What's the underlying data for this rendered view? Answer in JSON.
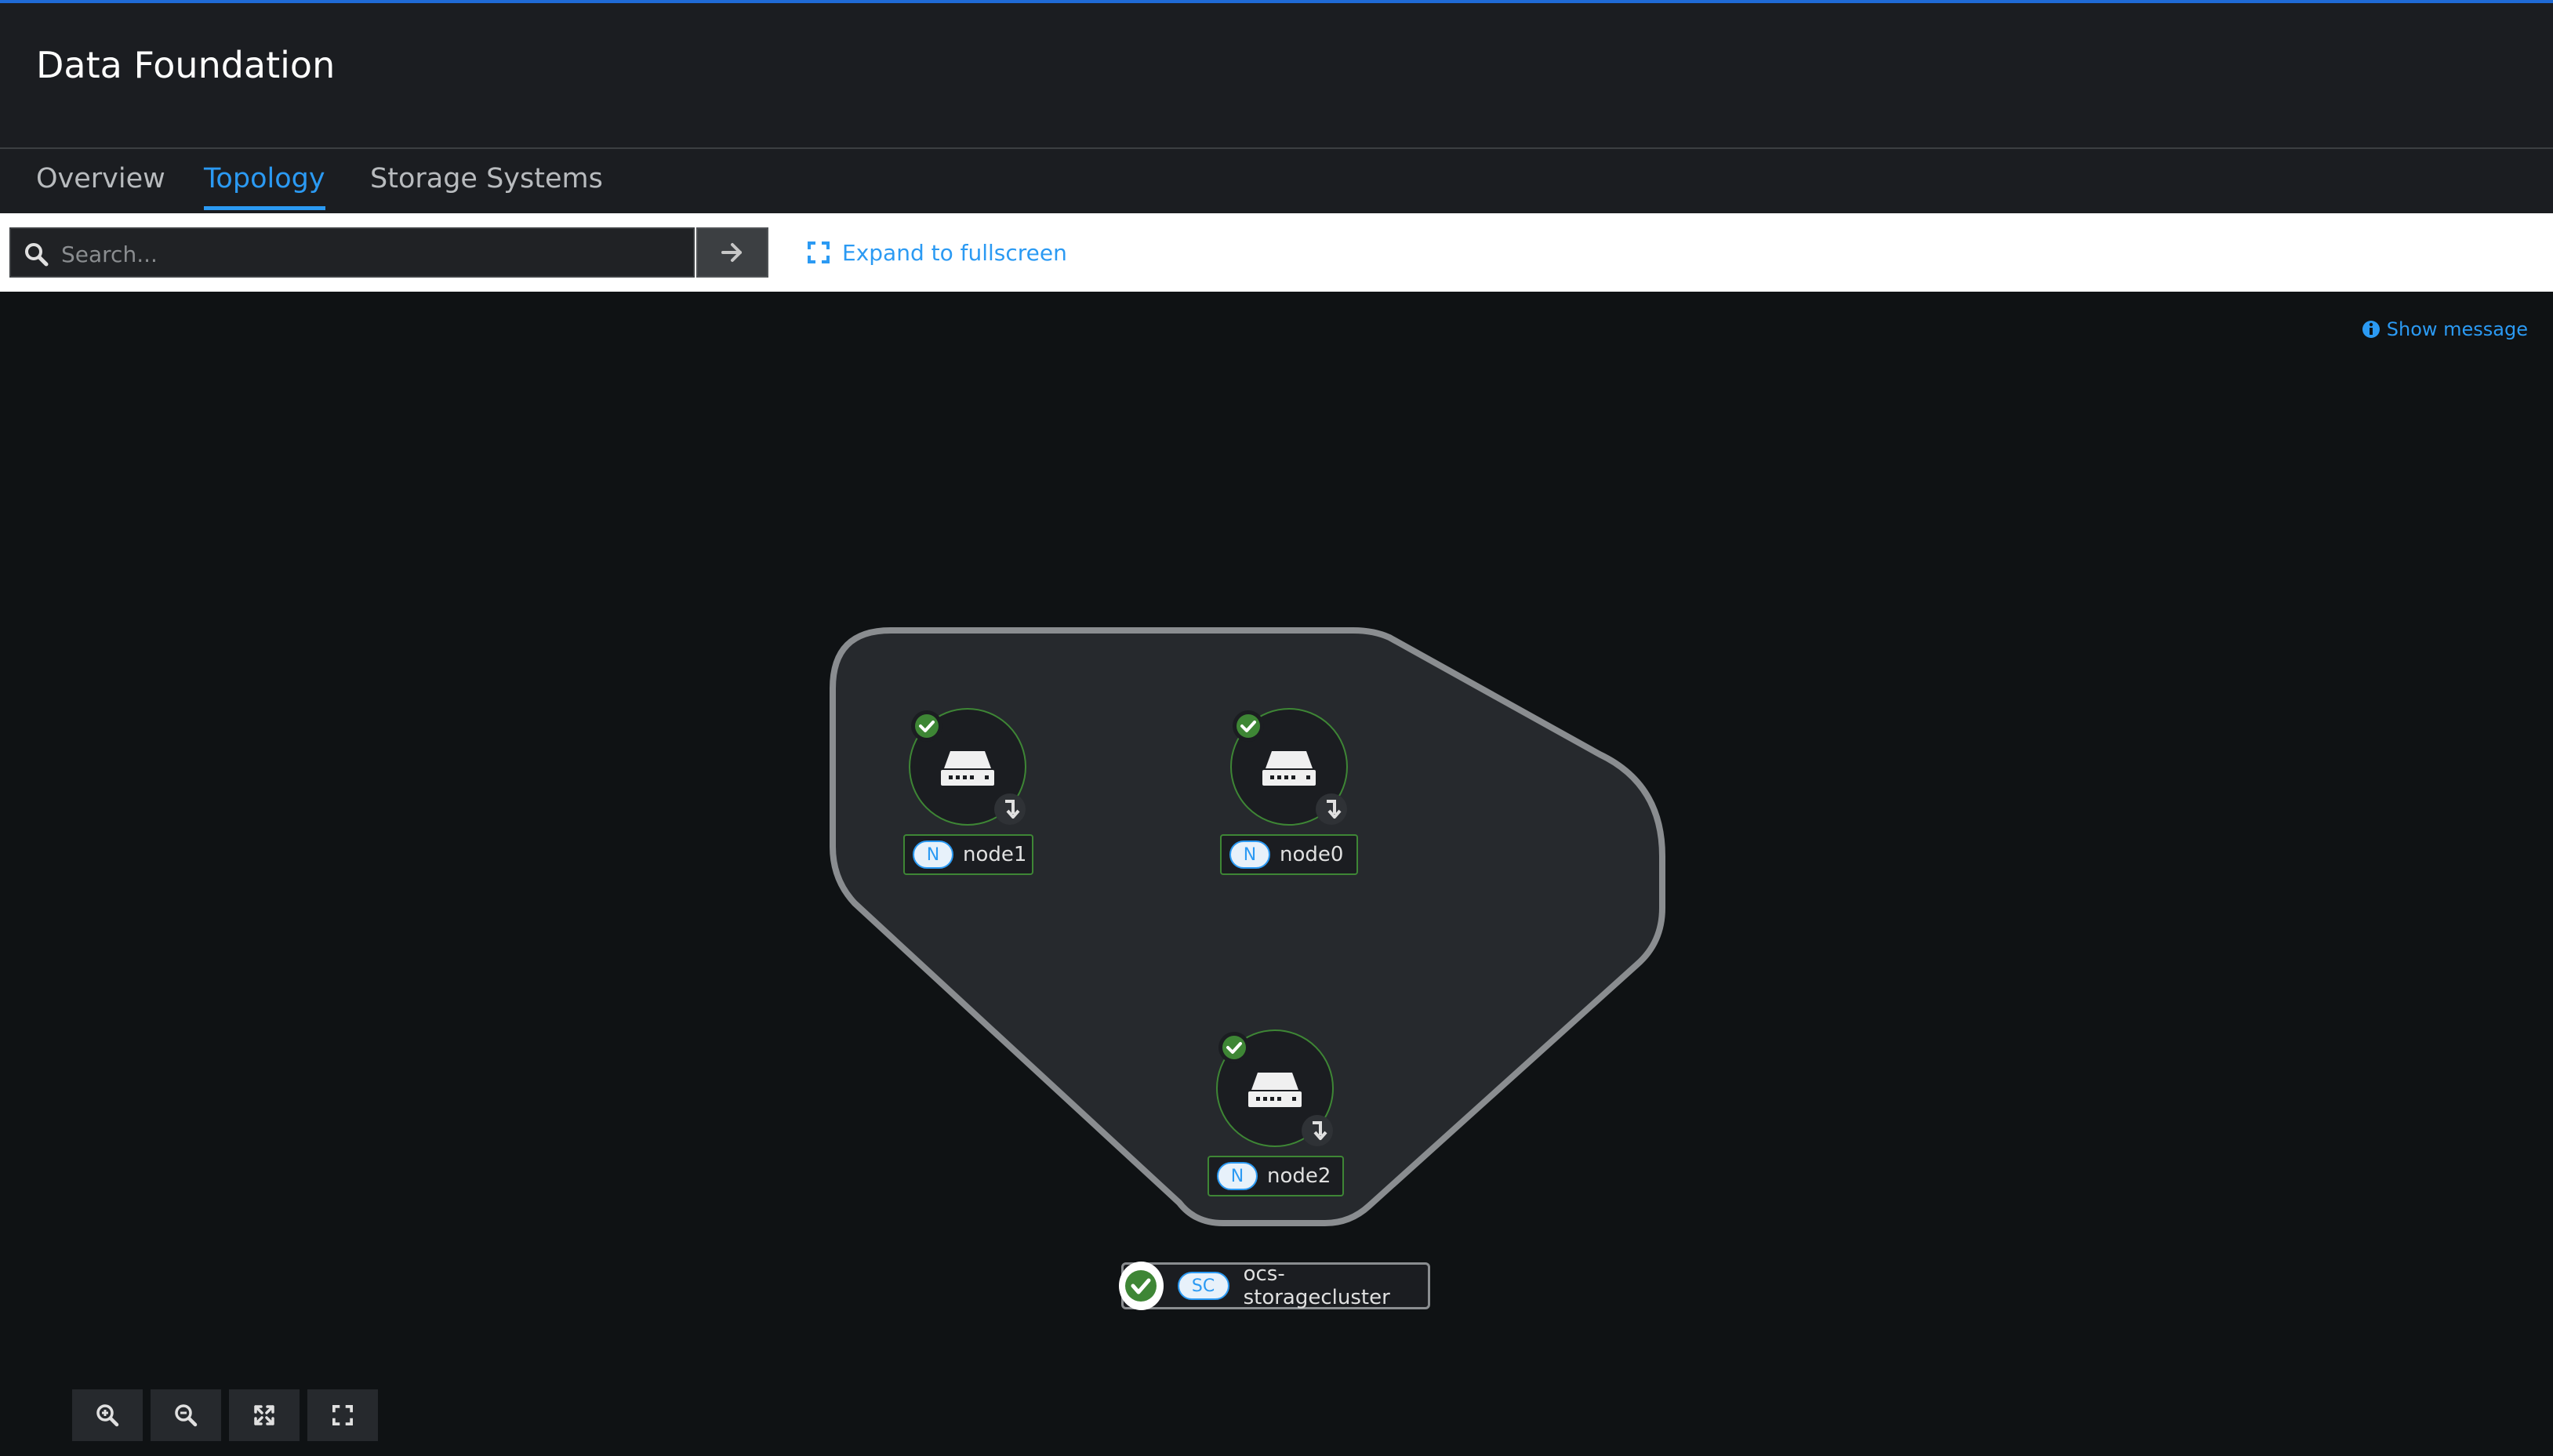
{
  "header": {
    "title": "Data Foundation"
  },
  "tabs": [
    {
      "label": "Overview",
      "active": false
    },
    {
      "label": "Topology",
      "active": true
    },
    {
      "label": "Storage Systems",
      "active": false
    }
  ],
  "toolbar": {
    "search_placeholder": "Search...",
    "expand_label": "Expand to fullscreen"
  },
  "canvas": {
    "show_message_label": "Show message",
    "nodes": [
      {
        "badge": "N",
        "name": "node1",
        "status": "ok"
      },
      {
        "badge": "N",
        "name": "node0",
        "status": "ok"
      },
      {
        "badge": "N",
        "name": "node2",
        "status": "ok"
      }
    ],
    "cluster": {
      "badge": "SC",
      "name": "ocs-storagecluster",
      "status": "ok"
    }
  },
  "controls": [
    "zoom-in",
    "zoom-out",
    "fit-to-screen",
    "reset-view"
  ],
  "colors": {
    "accent": "#2b9af3",
    "success": "#3e8635",
    "group_fill": "#26292d",
    "group_stroke": "#8a8d90"
  }
}
